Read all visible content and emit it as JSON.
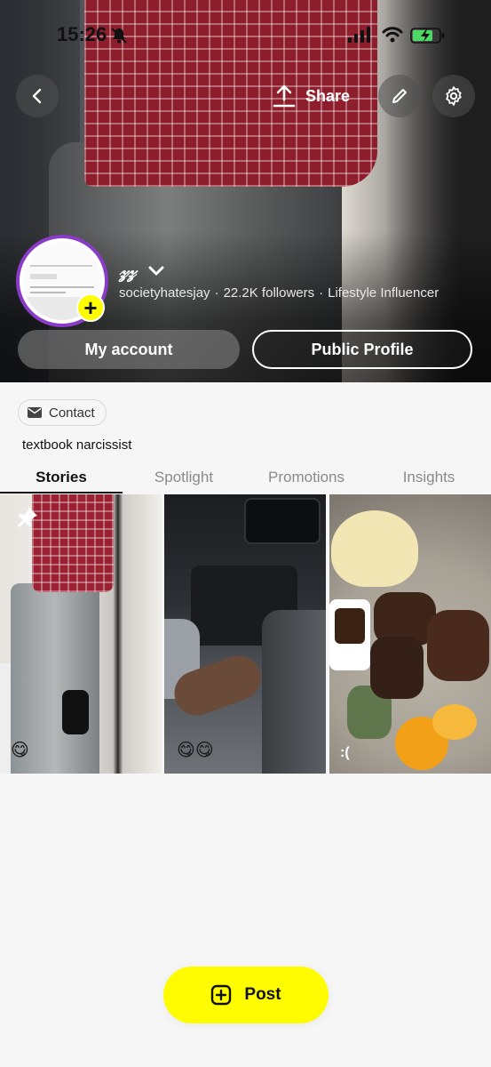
{
  "status_bar": {
    "time": "15:26"
  },
  "header": {
    "share_label": "Share"
  },
  "profile": {
    "display_name": "𝓏𝓏",
    "username": "societyhatesjay",
    "followers": "22.2K followers",
    "category": "Lifestyle Influencer",
    "separator": "·"
  },
  "actions": {
    "my_account": "My account",
    "public_profile": "Public Profile"
  },
  "contact": {
    "label": "Contact"
  },
  "bio": "textbook narcissist",
  "tabs": [
    {
      "label": "Stories"
    },
    {
      "label": "Spotlight"
    },
    {
      "label": "Promotions"
    },
    {
      "label": "Insights"
    }
  ],
  "stories": [
    {
      "caption": "😋"
    },
    {
      "caption": "😋😋"
    },
    {
      "caption": ":("
    }
  ],
  "post_button": {
    "label": "Post"
  },
  "colors": {
    "accent_yellow": "#fffc00",
    "avatar_ring": "#8a3bc8"
  }
}
